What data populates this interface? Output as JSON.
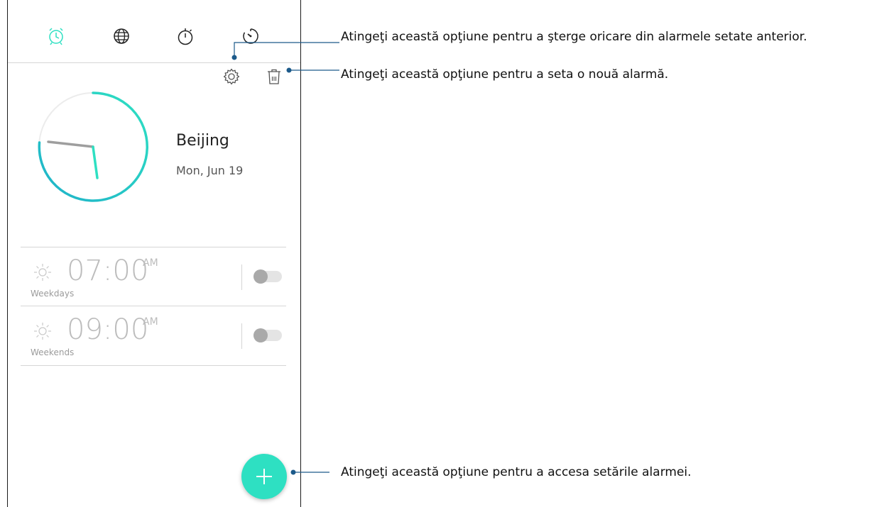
{
  "tabs": [
    {
      "name": "alarm-tab",
      "icon": "alarm-clock-icon",
      "active": true
    },
    {
      "name": "world-clock-tab",
      "icon": "globe-icon",
      "active": false
    },
    {
      "name": "stopwatch-tab",
      "icon": "stopwatch-icon",
      "active": false
    },
    {
      "name": "timer-tab",
      "icon": "timer-icon",
      "active": false
    }
  ],
  "actions": {
    "settings_icon": "gear-icon",
    "delete_icon": "trash-icon"
  },
  "world_clock": {
    "city": "Beijing",
    "date": "Mon, Jun 19"
  },
  "alarms": [
    {
      "time": "07:00",
      "ampm": "AM",
      "repeat": "Weekdays",
      "enabled": false,
      "icon": "sun-icon"
    },
    {
      "time": "09:00",
      "ampm": "AM",
      "repeat": "Weekends",
      "enabled": false,
      "icon": "sun-icon"
    }
  ],
  "fab": {
    "icon": "plus-icon"
  },
  "callouts": {
    "top": "Atingeţi această opţiune pentru a şterge oricare din alarmele setate anterior.",
    "middle": "Atingeţi această opţiune pentru a seta o nouă alarmă.",
    "bottom": "Atingeţi această opţiune pentru a accesa setările alarmei."
  },
  "colors": {
    "accent": "#2ee0c2",
    "callout_line": "#1c5a8a",
    "alarm_text": "#bcbcbc"
  }
}
